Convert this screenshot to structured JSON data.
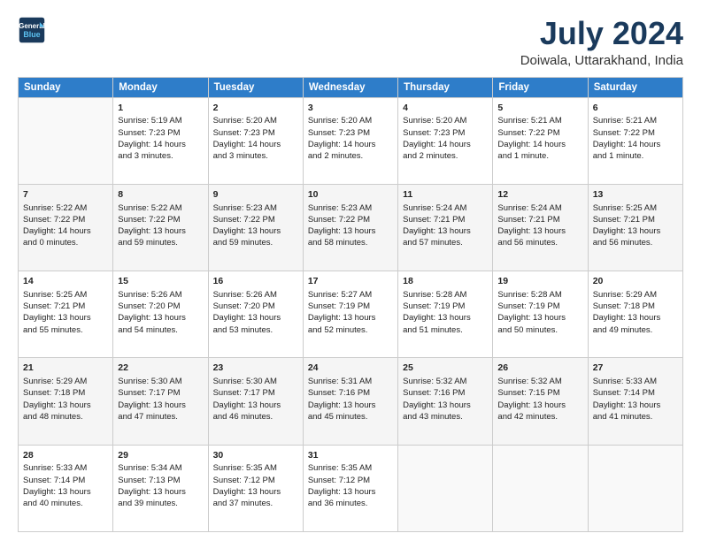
{
  "header": {
    "logo_line1": "General",
    "logo_line2": "Blue",
    "month": "July 2024",
    "location": "Doiwala, Uttarakhand, India"
  },
  "weekdays": [
    "Sunday",
    "Monday",
    "Tuesday",
    "Wednesday",
    "Thursday",
    "Friday",
    "Saturday"
  ],
  "weeks": [
    [
      {
        "day": "",
        "data": ""
      },
      {
        "day": "1",
        "data": "Sunrise: 5:19 AM\nSunset: 7:23 PM\nDaylight: 14 hours\nand 3 minutes."
      },
      {
        "day": "2",
        "data": "Sunrise: 5:20 AM\nSunset: 7:23 PM\nDaylight: 14 hours\nand 3 minutes."
      },
      {
        "day": "3",
        "data": "Sunrise: 5:20 AM\nSunset: 7:23 PM\nDaylight: 14 hours\nand 2 minutes."
      },
      {
        "day": "4",
        "data": "Sunrise: 5:20 AM\nSunset: 7:23 PM\nDaylight: 14 hours\nand 2 minutes."
      },
      {
        "day": "5",
        "data": "Sunrise: 5:21 AM\nSunset: 7:22 PM\nDaylight: 14 hours\nand 1 minute."
      },
      {
        "day": "6",
        "data": "Sunrise: 5:21 AM\nSunset: 7:22 PM\nDaylight: 14 hours\nand 1 minute."
      }
    ],
    [
      {
        "day": "7",
        "data": "Sunrise: 5:22 AM\nSunset: 7:22 PM\nDaylight: 14 hours\nand 0 minutes."
      },
      {
        "day": "8",
        "data": "Sunrise: 5:22 AM\nSunset: 7:22 PM\nDaylight: 13 hours\nand 59 minutes."
      },
      {
        "day": "9",
        "data": "Sunrise: 5:23 AM\nSunset: 7:22 PM\nDaylight: 13 hours\nand 59 minutes."
      },
      {
        "day": "10",
        "data": "Sunrise: 5:23 AM\nSunset: 7:22 PM\nDaylight: 13 hours\nand 58 minutes."
      },
      {
        "day": "11",
        "data": "Sunrise: 5:24 AM\nSunset: 7:21 PM\nDaylight: 13 hours\nand 57 minutes."
      },
      {
        "day": "12",
        "data": "Sunrise: 5:24 AM\nSunset: 7:21 PM\nDaylight: 13 hours\nand 56 minutes."
      },
      {
        "day": "13",
        "data": "Sunrise: 5:25 AM\nSunset: 7:21 PM\nDaylight: 13 hours\nand 56 minutes."
      }
    ],
    [
      {
        "day": "14",
        "data": "Sunrise: 5:25 AM\nSunset: 7:21 PM\nDaylight: 13 hours\nand 55 minutes."
      },
      {
        "day": "15",
        "data": "Sunrise: 5:26 AM\nSunset: 7:20 PM\nDaylight: 13 hours\nand 54 minutes."
      },
      {
        "day": "16",
        "data": "Sunrise: 5:26 AM\nSunset: 7:20 PM\nDaylight: 13 hours\nand 53 minutes."
      },
      {
        "day": "17",
        "data": "Sunrise: 5:27 AM\nSunset: 7:19 PM\nDaylight: 13 hours\nand 52 minutes."
      },
      {
        "day": "18",
        "data": "Sunrise: 5:28 AM\nSunset: 7:19 PM\nDaylight: 13 hours\nand 51 minutes."
      },
      {
        "day": "19",
        "data": "Sunrise: 5:28 AM\nSunset: 7:19 PM\nDaylight: 13 hours\nand 50 minutes."
      },
      {
        "day": "20",
        "data": "Sunrise: 5:29 AM\nSunset: 7:18 PM\nDaylight: 13 hours\nand 49 minutes."
      }
    ],
    [
      {
        "day": "21",
        "data": "Sunrise: 5:29 AM\nSunset: 7:18 PM\nDaylight: 13 hours\nand 48 minutes."
      },
      {
        "day": "22",
        "data": "Sunrise: 5:30 AM\nSunset: 7:17 PM\nDaylight: 13 hours\nand 47 minutes."
      },
      {
        "day": "23",
        "data": "Sunrise: 5:30 AM\nSunset: 7:17 PM\nDaylight: 13 hours\nand 46 minutes."
      },
      {
        "day": "24",
        "data": "Sunrise: 5:31 AM\nSunset: 7:16 PM\nDaylight: 13 hours\nand 45 minutes."
      },
      {
        "day": "25",
        "data": "Sunrise: 5:32 AM\nSunset: 7:16 PM\nDaylight: 13 hours\nand 43 minutes."
      },
      {
        "day": "26",
        "data": "Sunrise: 5:32 AM\nSunset: 7:15 PM\nDaylight: 13 hours\nand 42 minutes."
      },
      {
        "day": "27",
        "data": "Sunrise: 5:33 AM\nSunset: 7:14 PM\nDaylight: 13 hours\nand 41 minutes."
      }
    ],
    [
      {
        "day": "28",
        "data": "Sunrise: 5:33 AM\nSunset: 7:14 PM\nDaylight: 13 hours\nand 40 minutes."
      },
      {
        "day": "29",
        "data": "Sunrise: 5:34 AM\nSunset: 7:13 PM\nDaylight: 13 hours\nand 39 minutes."
      },
      {
        "day": "30",
        "data": "Sunrise: 5:35 AM\nSunset: 7:12 PM\nDaylight: 13 hours\nand 37 minutes."
      },
      {
        "day": "31",
        "data": "Sunrise: 5:35 AM\nSunset: 7:12 PM\nDaylight: 13 hours\nand 36 minutes."
      },
      {
        "day": "",
        "data": ""
      },
      {
        "day": "",
        "data": ""
      },
      {
        "day": "",
        "data": ""
      }
    ]
  ]
}
